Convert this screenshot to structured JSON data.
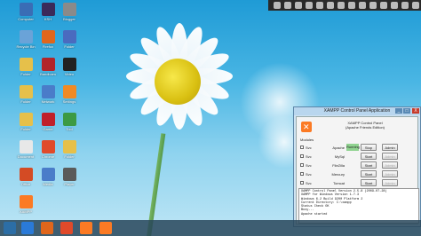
{
  "desktop": {
    "icons": [
      {
        "label": "Computer",
        "icon": "computer-icon",
        "color": "#3a6db5"
      },
      {
        "label": "KSH",
        "icon": "ksh-app-icon",
        "color": "#3b2a5a"
      },
      {
        "label": "Blogger",
        "icon": "blogger-icon",
        "color": "#8a8a8a"
      },
      {
        "label": "Recycle Bin",
        "icon": "recycle-bin-icon",
        "color": "#6aa3d8"
      },
      {
        "label": "Firefox",
        "icon": "firefox-icon",
        "color": "#e0661c"
      },
      {
        "label": "Folder",
        "icon": "app-window-icon",
        "color": "#4a6bbf"
      },
      {
        "label": "Folder",
        "icon": "folder-icon",
        "color": "#e6c04a"
      },
      {
        "label": "Bandicam",
        "icon": "bandicam-icon",
        "color": "#b2252a"
      },
      {
        "label": "Video",
        "icon": "video-app-icon",
        "color": "#222222"
      },
      {
        "label": "Folder",
        "icon": "folder-icon",
        "color": "#e6c04a"
      },
      {
        "label": "Network",
        "icon": "network-icon",
        "color": "#4a7cc9"
      },
      {
        "label": "Settings",
        "icon": "orange-app-icon",
        "color": "#f08a24"
      },
      {
        "label": "Folder",
        "icon": "folder-icon",
        "color": "#e6c04a"
      },
      {
        "label": "Game",
        "icon": "game-icon",
        "color": "#c0202a"
      },
      {
        "label": "Tool",
        "icon": "green-app-icon",
        "color": "#3c9a44"
      },
      {
        "label": "Document",
        "icon": "document-icon",
        "color": "#e8e8e8"
      },
      {
        "label": "Chrome",
        "icon": "chrome-icon",
        "color": "#e04a2a"
      },
      {
        "label": "Folder",
        "icon": "folder-icon",
        "color": "#e6c04a"
      },
      {
        "label": "Office",
        "icon": "office-icon",
        "color": "#d44b24"
      },
      {
        "label": "Media",
        "icon": "media-icon",
        "color": "#4a7cc9"
      },
      {
        "label": "Player",
        "icon": "player-icon",
        "color": "#5a5a5a"
      },
      {
        "label": "XAMPP",
        "icon": "xampp-icon",
        "color": "#fb7a24"
      }
    ]
  },
  "xampp": {
    "window_title": "XAMPP Control Panel Application",
    "header_line1": "XAMPP Control Panel",
    "header_line2": "(Apache Friends Edition)",
    "modules_label": "Modules",
    "service_label": "Svc",
    "minimize": "_",
    "maximize": "□",
    "close": "X",
    "modules": [
      {
        "name": "Apache",
        "status": "Running",
        "btn1": "Stop",
        "btn2": "Admin",
        "btn2_enabled": true
      },
      {
        "name": "MySql",
        "status": "",
        "btn1": "Start",
        "btn2": "Admin",
        "btn2_enabled": false
      },
      {
        "name": "FileZilla",
        "status": "",
        "btn1": "Start",
        "btn2": "Admin",
        "btn2_enabled": false
      },
      {
        "name": "Mercury",
        "status": "",
        "btn1": "Start",
        "btn2": "Admin",
        "btn2_enabled": false
      },
      {
        "name": "Tomcat",
        "status": "",
        "btn1": "Start",
        "btn2": "Admin",
        "btn2_enabled": false
      }
    ],
    "log": [
      "XAMPP Control Panel Version 2.5.8 (2009-07-28)",
      "XAMPP for Windows Version 1.7.3",
      "Windows 6.2 Build 9200 Platform 2",
      "Current Directory: C:\\xampp",
      "Status Check OK",
      "Busy...",
      "Apache started"
    ]
  },
  "taskbar": {
    "buttons": [
      {
        "icon": "internet-explorer-icon",
        "color": "#2a7ad8"
      },
      {
        "icon": "firefox-icon",
        "color": "#e0661c"
      },
      {
        "icon": "chrome-icon",
        "color": "#e04a2a"
      },
      {
        "icon": "xampp-icon",
        "color": "#fb7a24"
      },
      {
        "icon": "xampp-icon",
        "color": "#fb7a24"
      }
    ]
  }
}
